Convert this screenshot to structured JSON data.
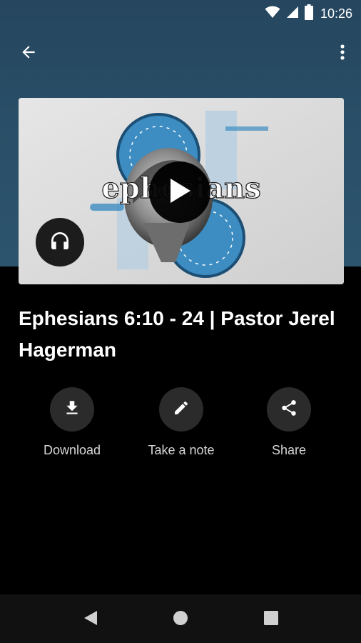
{
  "status_bar": {
    "time": "10:26",
    "icons": [
      "wifi-icon",
      "cellular-signal-icon",
      "battery-icon"
    ]
  },
  "toolbar": {
    "back_icon": "arrow-back-icon",
    "more_icon": "more-vert-icon"
  },
  "media": {
    "artwork_text": "ephesians",
    "play_icon": "play-icon",
    "audio_icon": "headphones-icon"
  },
  "sermon": {
    "title": "Ephesians 6:10 - 24 | Pastor Jerel Hagerman"
  },
  "actions": [
    {
      "label": "Download",
      "icon": "download-icon"
    },
    {
      "label": "Take a note",
      "icon": "pencil-icon"
    },
    {
      "label": "Share",
      "icon": "share-icon"
    }
  ],
  "nav_bar": {
    "icons": [
      "nav-back-icon",
      "nav-home-icon",
      "nav-recents-icon"
    ]
  },
  "colors": {
    "header_background": "#2a5069",
    "page_background": "#000000",
    "action_circle": "#2b2b2b",
    "artwork_blue": "#3d8dc2"
  }
}
